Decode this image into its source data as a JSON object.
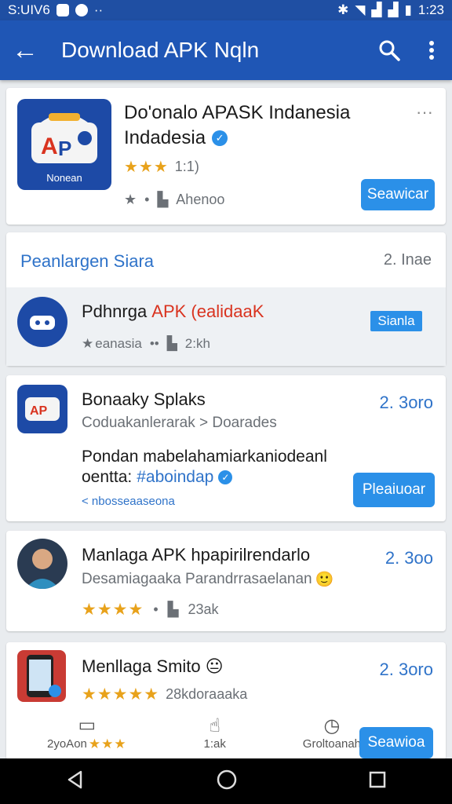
{
  "status": {
    "time_left": "S:UIV6",
    "time_right": "1:23"
  },
  "appbar": {
    "title": "Download APK Nqln"
  },
  "featured": {
    "title": "Do'onalo APASK Indanesia",
    "subtitle": "Indadesia",
    "rating_text": "1:1)",
    "meta_text": "Ahenoo",
    "logo_text": "Nonean",
    "button": "Seawicar"
  },
  "section": {
    "header": "Peanlargen Siara",
    "count": "2. Inae",
    "item": {
      "title_black": "Pdhnrgа ",
      "title_red": "APK (ealidaaK",
      "meta_left": "eanasia",
      "meta_right": "2:kh",
      "button": "Sianla"
    }
  },
  "apps": [
    {
      "title": "Bonaaky Splaks",
      "subtitle": "Coduakanlerarak > Doarades",
      "desc_line1": "Pondan mabelahamiarkaniodeanl",
      "desc_line2": "oentta: ",
      "tag": "#aboindap",
      "link": "< nbosseaaseona",
      "price": "2. 3oro",
      "button": "Pleaiuoar"
    },
    {
      "title": "Manlaga APK hpapirilrendarlo",
      "subtitle": "Desamiagaaka Parandrrasaelanan",
      "meta": "23ak",
      "price": "2. 3oo"
    },
    {
      "title": "Menllaga Smito",
      "meta": "28kdoraaaka",
      "price": "2. 3oro"
    }
  ],
  "bottom_tabs": [
    {
      "label": "2yoAon"
    },
    {
      "label": "1:ak"
    },
    {
      "label": "Groltoanah"
    }
  ],
  "bottom_button": "Seawioa",
  "colors": {
    "primary": "#1f56b5",
    "accent": "#2b90e8",
    "star": "#e8a21b",
    "red": "#d9331f"
  }
}
